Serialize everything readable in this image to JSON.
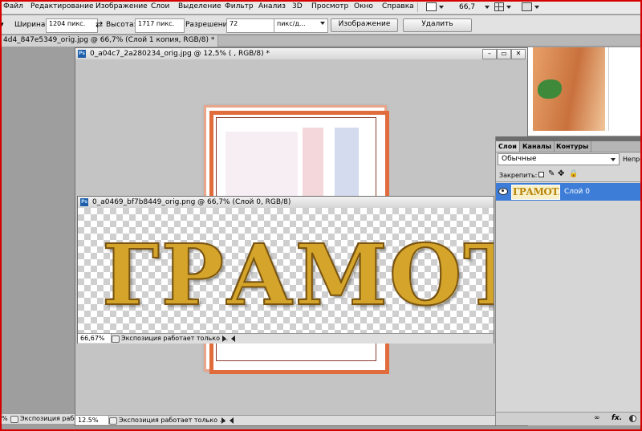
{
  "menu": {
    "items": [
      "Файл",
      "Редактирование",
      "Изображение",
      "Слои",
      "Выделение",
      "Фильтр",
      "Анализ",
      "3D",
      "Просмотр",
      "Окно",
      "Справка"
    ],
    "zoom": "66,7"
  },
  "options": {
    "width_label": "Ширина:",
    "width_value": "1204 пикс.",
    "height_label": "Высота:",
    "height_value": "1717 пикс.",
    "resolution_label": "Разрешение:",
    "resolution_value": "72",
    "resolution_unit": "пикс/д...",
    "image_button": "Изображение",
    "delete_button": "Удалить"
  },
  "doc_tab": {
    "title": "4d4_847e5349_orig.jpg @ 66,7% (Слой 1 копия, RGB/8) *"
  },
  "window1": {
    "title": "0_a04c7_2a280234_orig.jpg @ 12,5% ( , RGB/8) *",
    "zoom": "12.5%",
    "status": "Экспозиция работает только ..."
  },
  "window2": {
    "title": "0_a0469_bf7b8449_orig.png @ 66,7% (Слой 0, RGB/8)",
    "zoom": "66,67%",
    "status": "Экспозиция работает только ...",
    "artwork_text": "ГРАМОТ"
  },
  "back_window": {
    "zoom": "%",
    "status": "Экспозиция работает"
  },
  "layers_panel": {
    "tabs": [
      "Слои",
      "Каналы",
      "Контуры"
    ],
    "blend_mode": "Обычные",
    "opacity_label": "Непроз",
    "lock_label": "Закрепить:",
    "layer_name": "Слой 0",
    "thumb_text": "ГРАМОТА",
    "fx_label": "fx."
  },
  "colors": {
    "selection": "#3d7dd8",
    "frame_red": "#d40000",
    "cert_orange": "#e06b3b"
  }
}
